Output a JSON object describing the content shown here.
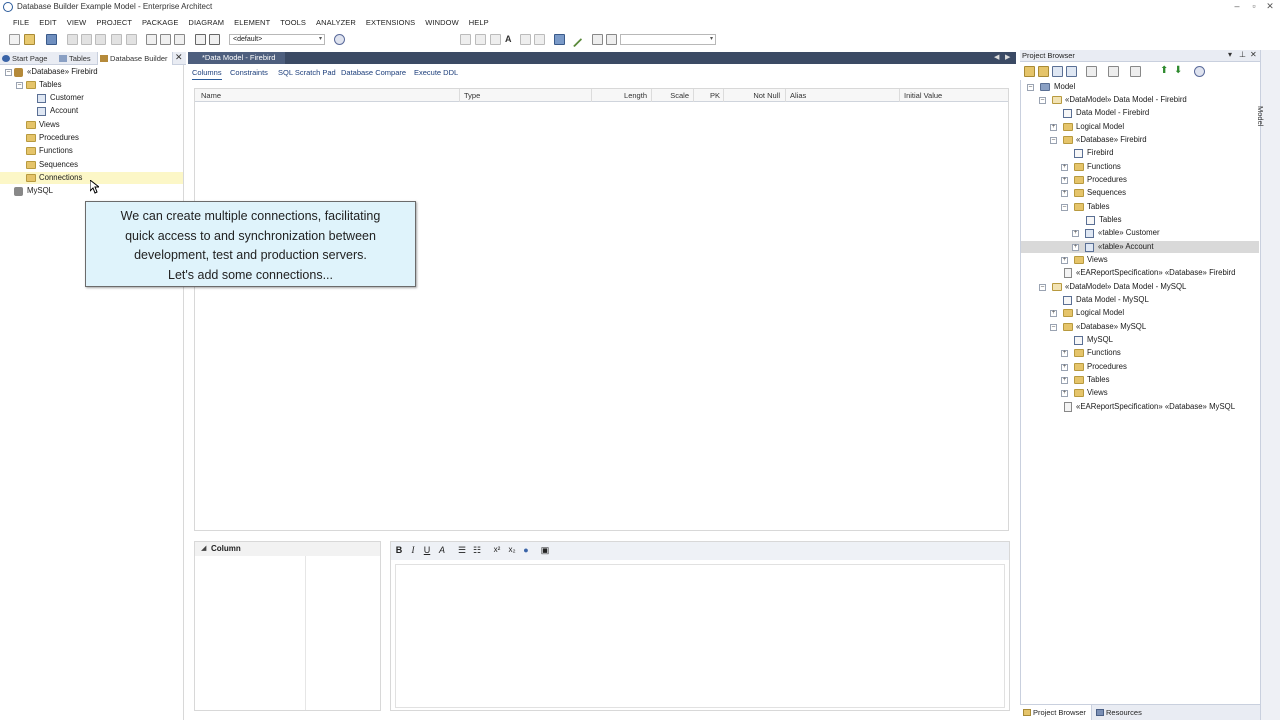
{
  "window": {
    "title": "Database Builder Example Model - Enterprise Architect"
  },
  "menu": [
    "FILE",
    "EDIT",
    "VIEW",
    "PROJECT",
    "PACKAGE",
    "DIAGRAM",
    "ELEMENT",
    "TOOLS",
    "ANALYZER",
    "EXTENSIONS",
    "WINDOW",
    "HELP"
  ],
  "toolbar": {
    "perspective_value": "<default>",
    "search_value": ""
  },
  "left_tabs": {
    "start_page": "Start Page",
    "tables": "Tables",
    "database_builder": "Database Builder"
  },
  "db_tree": {
    "database": "«Database» Firebird",
    "tables": "Tables",
    "customer": "Customer",
    "account": "Account",
    "views": "Views",
    "procedures": "Procedures",
    "functions": "Functions",
    "sequences": "Sequences",
    "connections": "Connections",
    "mysql": "MySQL"
  },
  "document": {
    "tab": "*Data Model - Firebird",
    "subtabs": [
      "Columns",
      "Constraints",
      "SQL Scratch Pad",
      "Database Compare",
      "Execute DDL"
    ]
  },
  "grid": {
    "columns": [
      "Name",
      "Type",
      "Length",
      "Scale",
      "PK",
      "Not Null",
      "Alias",
      "Initial Value"
    ]
  },
  "column_panel": {
    "label": "Column"
  },
  "tooltip": {
    "line1": "We can create multiple connections, facilitating",
    "line2": "quick access to and synchronization between",
    "line3": "development, test and production servers.",
    "line4": "Let's add some connections..."
  },
  "project_browser": {
    "title": "Project Browser",
    "items": {
      "model": "Model",
      "dm_firebird": "«DataModel» Data Model - Firebird",
      "dm_firebird_diagram": "Data Model - Firebird",
      "logical_model_1": "Logical Model",
      "db_firebird": "«Database» Firebird",
      "firebird": "Firebird",
      "functions_1": "Functions",
      "procedures_1": "Procedures",
      "sequences_1": "Sequences",
      "tables_1": "Tables",
      "tables_diagram": "Tables",
      "table_customer": "«table» Customer",
      "table_account": "«table» Account",
      "views_1": "Views",
      "report_firebird": "«EAReportSpecification» «Database» Firebird",
      "dm_mysql": "«DataModel» Data Model - MySQL",
      "dm_mysql_diagram": "Data Model - MySQL",
      "logical_model_2": "Logical Model",
      "db_mysql": "«Database» MySQL",
      "mysql": "MySQL",
      "functions_2": "Functions",
      "procedures_2": "Procedures",
      "tables_2": "Tables",
      "views_2": "Views",
      "report_mysql": "«EAReportSpecification» «Database» MySQL"
    },
    "bottom_tabs": {
      "project_browser": "Project Browser",
      "resources": "Resources"
    },
    "side_label": "Model"
  }
}
